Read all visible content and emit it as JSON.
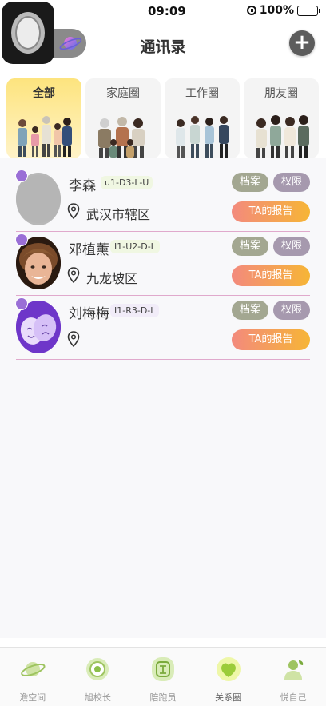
{
  "status": {
    "time": "09:09",
    "battery": "100%"
  },
  "header": {
    "title": "通讯录",
    "add_symbol": "+"
  },
  "tabs": [
    {
      "label": "全部",
      "active": true
    },
    {
      "label": "家庭圈",
      "active": false
    },
    {
      "label": "工作圈",
      "active": false
    },
    {
      "label": "朋友圈",
      "active": false
    }
  ],
  "contacts": [
    {
      "name": "李森",
      "code": "u1-D3-L-U",
      "location": "武汉市辖区",
      "archive": "档案",
      "permission": "权限",
      "report": "TA的报告"
    },
    {
      "name": "邓植薰",
      "code": "I1-U2-D-L",
      "location": "九龙坡区",
      "archive": "档案",
      "permission": "权限",
      "report": "TA的报告"
    },
    {
      "name": "刘梅梅",
      "code": "I1-R3-D-L",
      "location": "",
      "archive": "档案",
      "permission": "权限",
      "report": "TA的报告"
    }
  ],
  "nav": [
    {
      "label": "澹空间",
      "icon": "planet-icon"
    },
    {
      "label": "旭校长",
      "icon": "eye-circle-icon"
    },
    {
      "label": "陪跑员",
      "icon": "seal-icon"
    },
    {
      "label": "关系圈",
      "icon": "heart-leaf-icon",
      "active": true
    },
    {
      "label": "悦自己",
      "icon": "person-leaf-icon"
    }
  ],
  "colors": {
    "accent_yellow": "#fde47e",
    "archive_btn": "#a3a791",
    "perm_btn": "#a699ae",
    "report_from": "#f38a7d",
    "report_to": "#f6b536",
    "divider": "#e0a9cc"
  }
}
